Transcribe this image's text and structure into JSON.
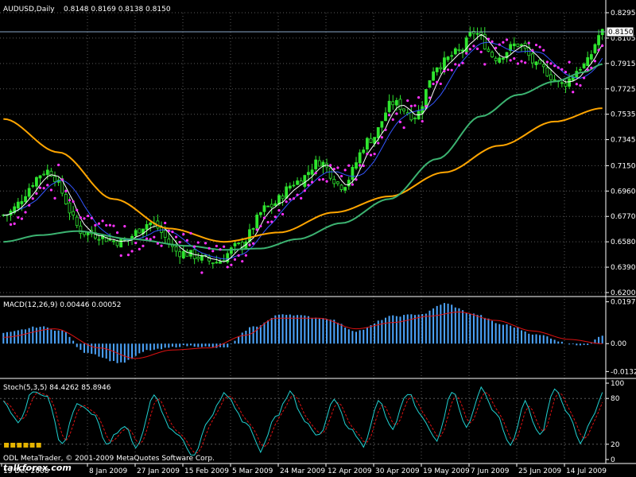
{
  "window": {
    "symbol_title": "AUDUSD,Daily",
    "ohlc": "0.8148 0.8169 0.8138 0.8150",
    "current_price": "0.8150",
    "watermark": "ODL MetaTrader, © 2001-2009 MetaQuotes Software Corp.",
    "site_logo": "talkforex.com"
  },
  "colors": {
    "background": "#000000",
    "grid": "#5a5a5a",
    "border": "#ffffff",
    "text": "#ffffff",
    "candle": "#2fe52f",
    "sma_fast": "#ffffff",
    "sma_mid": "#3355ff",
    "sma_slow": "#3cb371",
    "sma_long": "#ffa500",
    "sar": "#ff33ff",
    "macd_hist": "#4da6ff",
    "macd_signal": "#dd1111",
    "stoch_main": "#20d0d0",
    "stoch_signal": "#dd1111"
  },
  "chart_data": [
    {
      "type": "candlestick",
      "title": "AUDUSD,Daily",
      "subtitle": "0.8148 0.8169 0.8138 0.8150",
      "x_ticks": [
        "19 Dec 2008",
        "8 Jan 2009",
        "27 Jan 2009",
        "15 Feb 2009",
        "5 Mar 2009",
        "24 Mar 2009",
        "12 Apr 2009",
        "30 Apr 2009",
        "19 May 2009",
        "7 Jun 2009",
        "25 Jun 2009",
        "14 Jul 2009"
      ],
      "y_ticks": [
        "0.8295",
        "0.8105",
        "0.7915",
        "0.7725",
        "0.7535",
        "0.7345",
        "0.7150",
        "0.6960",
        "0.6770",
        "0.6580",
        "0.6390",
        "0.6200"
      ],
      "ylim": [
        0.62,
        0.8295
      ],
      "current_price": 0.815,
      "grid": true,
      "close_anchors": [
        [
          0,
          0.678
        ],
        [
          12,
          0.711
        ],
        [
          22,
          0.665
        ],
        [
          32,
          0.658
        ],
        [
          40,
          0.672
        ],
        [
          48,
          0.65
        ],
        [
          58,
          0.643
        ],
        [
          64,
          0.655
        ],
        [
          72,
          0.684
        ],
        [
          80,
          0.703
        ],
        [
          86,
          0.718
        ],
        [
          92,
          0.7
        ],
        [
          100,
          0.735
        ],
        [
          106,
          0.762
        ],
        [
          112,
          0.752
        ],
        [
          118,
          0.79
        ],
        [
          124,
          0.8
        ],
        [
          128,
          0.815
        ],
        [
          134,
          0.796
        ],
        [
          140,
          0.806
        ],
        [
          146,
          0.788
        ],
        [
          152,
          0.776
        ],
        [
          158,
          0.79
        ],
        [
          163,
          0.815
        ]
      ],
      "overlays": [
        {
          "name": "sma_long",
          "color": "#ffa500",
          "points": [
            [
              0,
              0.75
            ],
            [
              15,
              0.725
            ],
            [
              30,
              0.69
            ],
            [
              45,
              0.668
            ],
            [
              60,
              0.658
            ],
            [
              75,
              0.665
            ],
            [
              90,
              0.68
            ],
            [
              105,
              0.692
            ],
            [
              120,
              0.71
            ],
            [
              135,
              0.73
            ],
            [
              150,
              0.748
            ],
            [
              163,
              0.758
            ]
          ]
        },
        {
          "name": "sma_slow",
          "color": "#3cb371",
          "points": [
            [
              0,
              0.658
            ],
            [
              10,
              0.663
            ],
            [
              20,
              0.666
            ],
            [
              35,
              0.66
            ],
            [
              50,
              0.655
            ],
            [
              60,
              0.652
            ],
            [
              70,
              0.653
            ],
            [
              80,
              0.66
            ],
            [
              92,
              0.672
            ],
            [
              105,
              0.69
            ],
            [
              118,
              0.72
            ],
            [
              130,
              0.752
            ],
            [
              140,
              0.768
            ],
            [
              150,
              0.778
            ],
            [
              158,
              0.785
            ],
            [
              163,
              0.791
            ]
          ]
        }
      ]
    },
    {
      "type": "bar",
      "title": "MACD(12,26,9) 0.00446 0.00052",
      "y_ticks": [
        "0.01979",
        "0.00",
        "-0.0132"
      ],
      "ylim": [
        -0.0142,
        0.0204
      ],
      "hist_anchors": [
        [
          0,
          0.005
        ],
        [
          10,
          0.008
        ],
        [
          16,
          0.006
        ],
        [
          22,
          -0.004
        ],
        [
          32,
          -0.009
        ],
        [
          40,
          -0.003
        ],
        [
          50,
          -0.001
        ],
        [
          60,
          -0.002
        ],
        [
          68,
          0.008
        ],
        [
          76,
          0.014
        ],
        [
          88,
          0.012
        ],
        [
          96,
          0.006
        ],
        [
          106,
          0.013
        ],
        [
          114,
          0.014
        ],
        [
          120,
          0.019
        ],
        [
          128,
          0.014
        ],
        [
          136,
          0.009
        ],
        [
          146,
          0.004
        ],
        [
          154,
          0.0
        ],
        [
          158,
          -0.001
        ],
        [
          163,
          0.004
        ]
      ],
      "signal_anchors": [
        [
          0,
          0.003
        ],
        [
          14,
          0.007
        ],
        [
          26,
          -0.002
        ],
        [
          36,
          -0.007
        ],
        [
          46,
          -0.003
        ],
        [
          56,
          -0.002
        ],
        [
          66,
          0.004
        ],
        [
          74,
          0.012
        ],
        [
          86,
          0.012
        ],
        [
          96,
          0.007
        ],
        [
          106,
          0.01
        ],
        [
          116,
          0.013
        ],
        [
          124,
          0.015
        ],
        [
          134,
          0.011
        ],
        [
          144,
          0.006
        ],
        [
          154,
          0.002
        ],
        [
          163,
          0.0
        ]
      ]
    },
    {
      "type": "line",
      "title": "Stoch(5,3,5) 84.4262 85.8946",
      "y_ticks": [
        "100",
        "80",
        "20",
        "0"
      ],
      "ylim": [
        0,
        100
      ],
      "k_anchors": [
        [
          0,
          78
        ],
        [
          4,
          48
        ],
        [
          8,
          88
        ],
        [
          12,
          80
        ],
        [
          16,
          18
        ],
        [
          20,
          72
        ],
        [
          25,
          58
        ],
        [
          28,
          22
        ],
        [
          33,
          45
        ],
        [
          36,
          15
        ],
        [
          41,
          82
        ],
        [
          46,
          38
        ],
        [
          52,
          6
        ],
        [
          56,
          52
        ],
        [
          60,
          86
        ],
        [
          66,
          48
        ],
        [
          70,
          12
        ],
        [
          74,
          55
        ],
        [
          78,
          88
        ],
        [
          82,
          52
        ],
        [
          86,
          30
        ],
        [
          90,
          78
        ],
        [
          94,
          40
        ],
        [
          98,
          18
        ],
        [
          102,
          76
        ],
        [
          106,
          42
        ],
        [
          110,
          88
        ],
        [
          114,
          55
        ],
        [
          118,
          25
        ],
        [
          122,
          90
        ],
        [
          126,
          45
        ],
        [
          130,
          92
        ],
        [
          134,
          62
        ],
        [
          138,
          18
        ],
        [
          142,
          76
        ],
        [
          146,
          30
        ],
        [
          150,
          95
        ],
        [
          154,
          60
        ],
        [
          157,
          18
        ],
        [
          160,
          50
        ],
        [
          163,
          88
        ]
      ]
    }
  ]
}
